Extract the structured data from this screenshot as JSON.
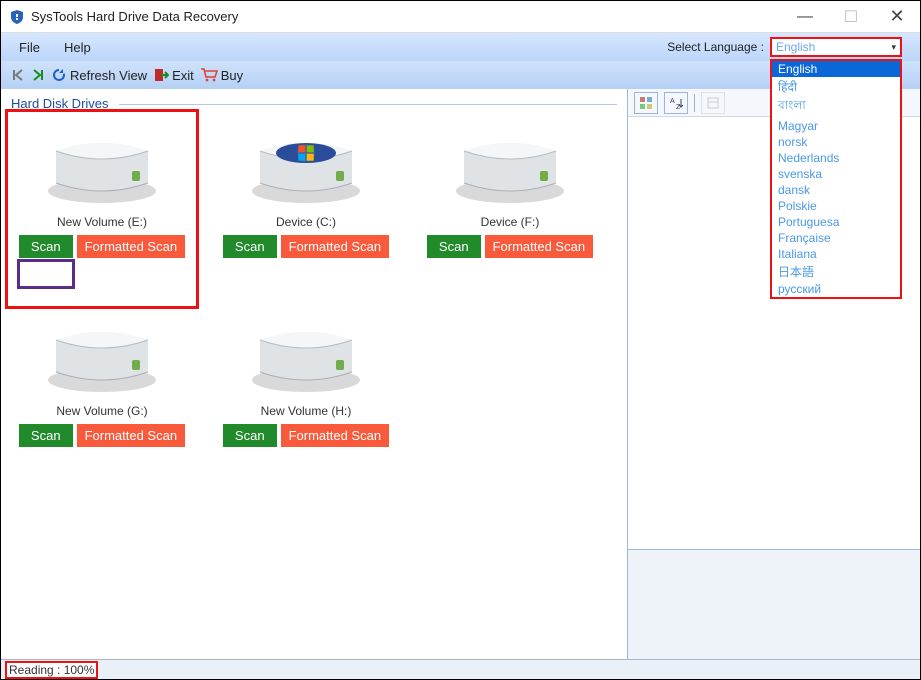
{
  "title": {
    "brand": "SysTools",
    "rest": " Hard Drive Data Recovery"
  },
  "menu": {
    "file": "File",
    "help": "Help"
  },
  "language": {
    "label": "Select Language :",
    "selected": "English",
    "options": [
      "English",
      "हिंदी",
      "বাংলা",
      "Magyar",
      "norsk",
      "Nederlands",
      "svenska",
      "dansk",
      "Polskie",
      "Portuguesa",
      "Française",
      "Italiana",
      "日本語",
      "русский"
    ]
  },
  "toolbar": {
    "refresh": "Refresh View",
    "exit": "Exit",
    "buy": "Buy"
  },
  "group_header": "Hard Disk Drives",
  "drives": [
    {
      "name": "New Volume (E:)",
      "scan": "Scan",
      "fmt": "Formatted Scan",
      "highlight_red": true,
      "highlight_scan_purple": true,
      "os_icon": false
    },
    {
      "name": "Device (C:)",
      "scan": "Scan",
      "fmt": "Formatted Scan",
      "highlight_red": false,
      "highlight_scan_purple": false,
      "os_icon": true
    },
    {
      "name": "Device (F:)",
      "scan": "Scan",
      "fmt": "Formatted Scan",
      "highlight_red": false,
      "highlight_scan_purple": false,
      "os_icon": false
    },
    {
      "name": "New Volume (G:)",
      "scan": "Scan",
      "fmt": "Formatted Scan",
      "highlight_red": false,
      "highlight_scan_purple": false,
      "os_icon": false
    },
    {
      "name": "New Volume (H:)",
      "scan": "Scan",
      "fmt": "Formatted Scan",
      "highlight_red": false,
      "highlight_scan_purple": false,
      "os_icon": false
    }
  ],
  "status": {
    "reading": "Reading : 100%"
  }
}
